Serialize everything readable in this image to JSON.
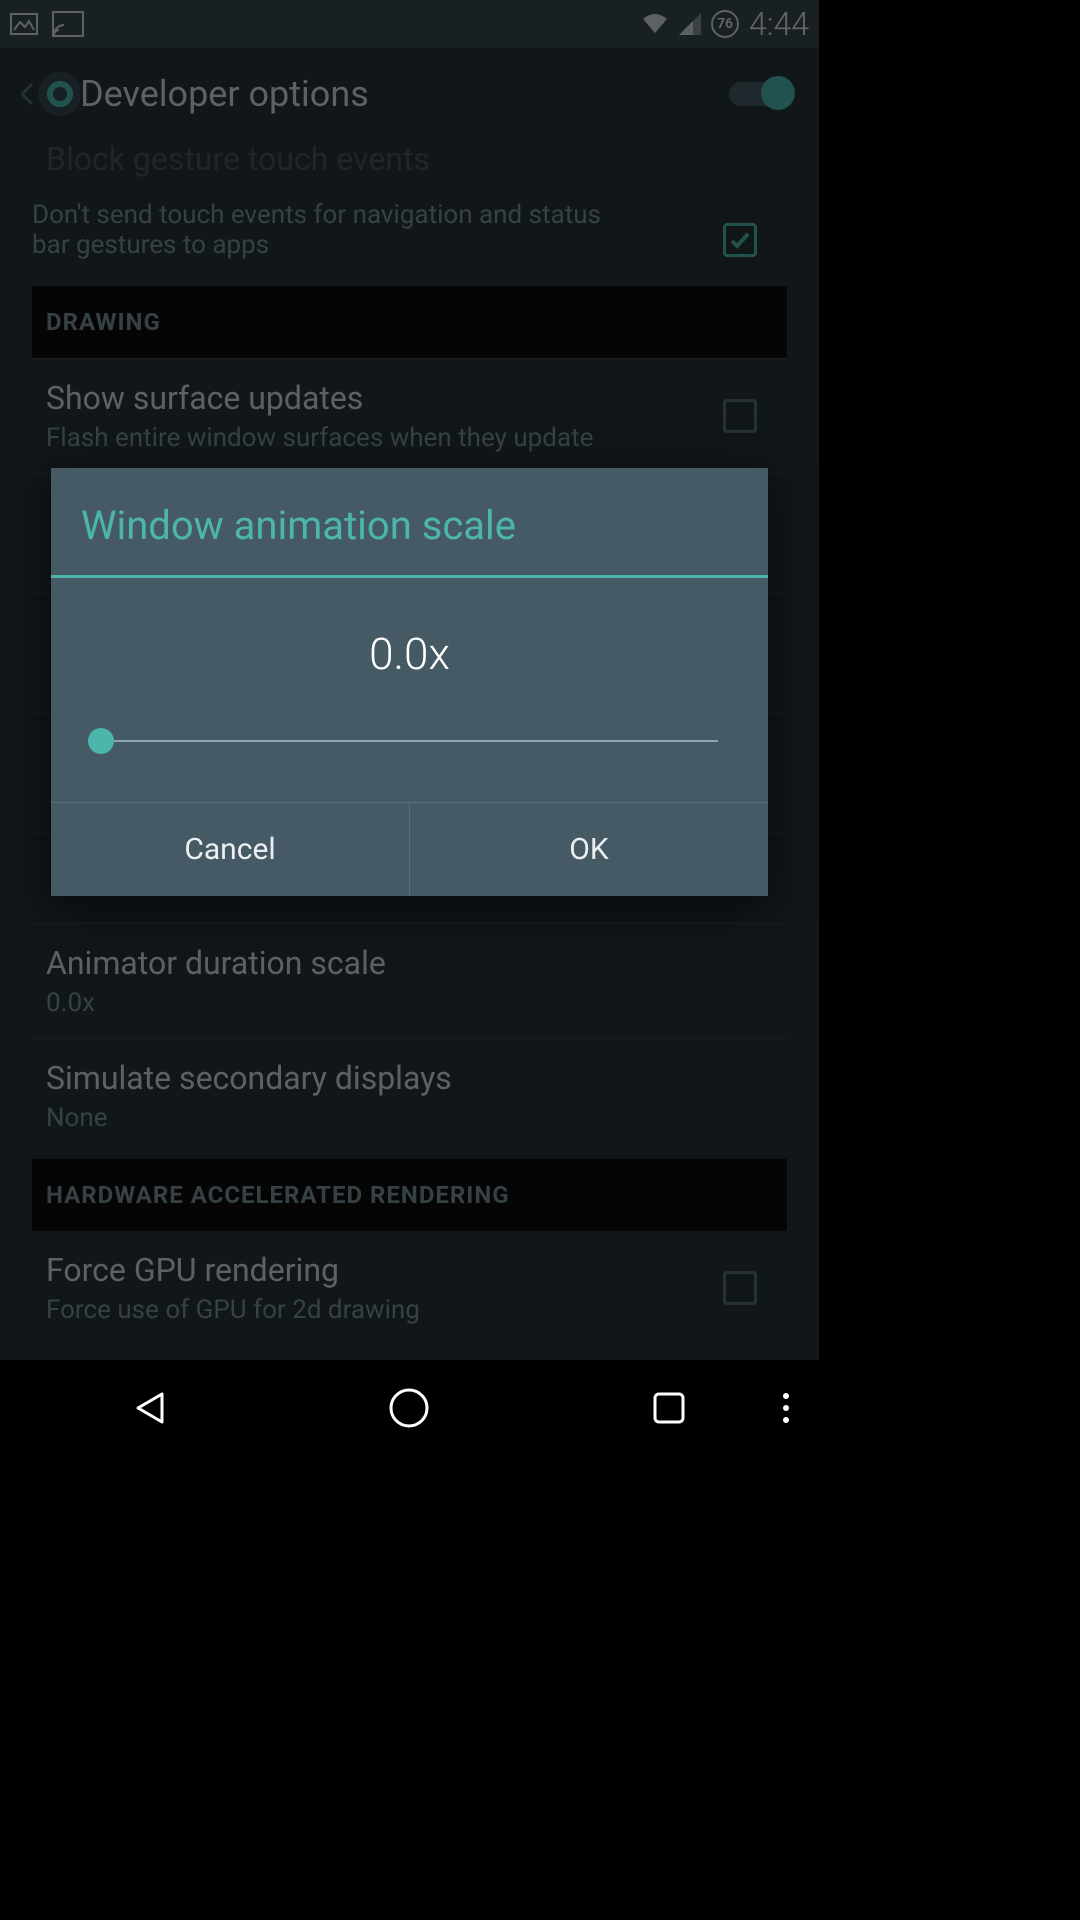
{
  "status": {
    "battery": "76",
    "time": "4:44"
  },
  "appbar": {
    "title": "Developer options"
  },
  "rows": {
    "block_gesture_title": "Block gesture touch events",
    "block_gesture_sub": "Don't send touch events for navigation and status bar gestures to apps",
    "section_drawing": "DRAWING",
    "surface_title": "Show surface updates",
    "surface_sub": "Flash entire window surfaces when they update",
    "animator_title": "Animator duration scale",
    "animator_sub": "0.0x",
    "simulate_title": "Simulate secondary displays",
    "simulate_sub": "None",
    "section_hw": "HARDWARE ACCELERATED RENDERING",
    "gpu_title": "Force GPU rendering",
    "gpu_sub": "Force use of GPU for 2d drawing"
  },
  "dialog": {
    "title": "Window animation scale",
    "value": "0.0x",
    "cancel": "Cancel",
    "ok": "OK"
  }
}
